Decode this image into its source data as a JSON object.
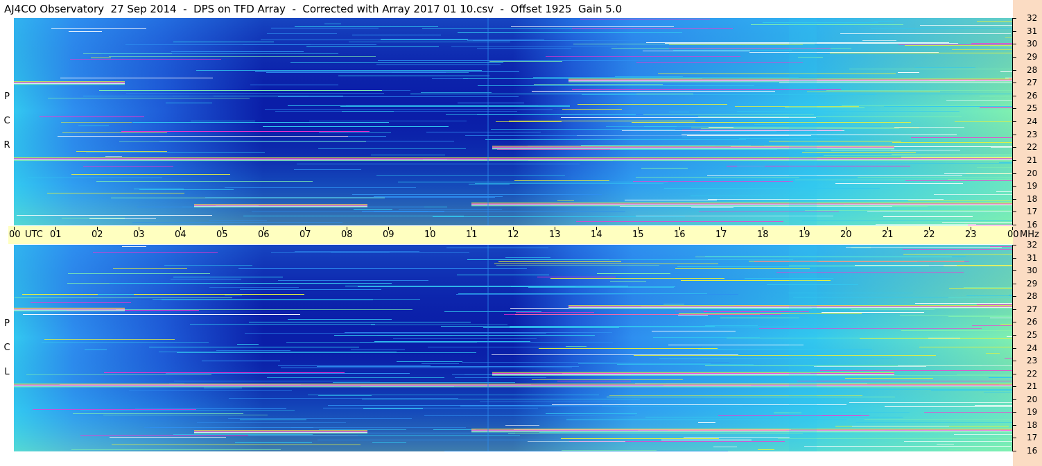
{
  "title": "AJ4CO Observatory  27 Sep 2014  -  DPS on TFD Array  -  Corrected with Array 2017 01 10.csv  -  Offset 1925  Gain 5.0",
  "chart_data": [
    {
      "type": "heatmap",
      "panel": "rcp",
      "ylabel_letters": [
        "P",
        "C",
        "R"
      ],
      "x_unit": "UTC",
      "y_unit": "MHz",
      "x_ticks": [
        "00",
        "01",
        "02",
        "03",
        "04",
        "05",
        "06",
        "07",
        "08",
        "09",
        "10",
        "11",
        "12",
        "13",
        "14",
        "15",
        "16",
        "17",
        "18",
        "19",
        "20",
        "21",
        "22",
        "23",
        "00"
      ],
      "y_ticks": [
        32,
        31,
        30,
        29,
        28,
        27,
        26,
        25,
        24,
        23,
        22,
        21,
        20,
        19,
        18,
        17,
        16
      ],
      "xlim": [
        0,
        24
      ],
      "ylim": [
        16,
        32
      ],
      "colormap": [
        "#0a1ea8",
        "#1e5cd8",
        "#2e8ff0",
        "#32c8f0",
        "#7ff0b0",
        "#e8f23c",
        "#ff2fd0",
        "#ffffff"
      ]
    },
    {
      "type": "heatmap",
      "panel": "lcp",
      "ylabel_letters": [
        "P",
        "C",
        "L"
      ],
      "x_unit": "UTC",
      "y_unit": "MHz",
      "x_ticks": [
        "00",
        "01",
        "02",
        "03",
        "04",
        "05",
        "06",
        "07",
        "08",
        "09",
        "10",
        "11",
        "12",
        "13",
        "14",
        "15",
        "16",
        "17",
        "18",
        "19",
        "20",
        "21",
        "22",
        "23",
        "00"
      ],
      "y_ticks": [
        32,
        31,
        30,
        29,
        28,
        27,
        26,
        25,
        24,
        23,
        22,
        21,
        20,
        19,
        18,
        17,
        16
      ],
      "xlim": [
        0,
        24
      ],
      "ylim": [
        16,
        32
      ],
      "colormap": [
        "#0a1ea8",
        "#1e5cd8",
        "#2e8ff0",
        "#32c8f0",
        "#7ff0b0",
        "#e8f23c",
        "#ff2fd0",
        "#ffffff"
      ]
    }
  ],
  "colors": {
    "axis_band": "#ffffc0",
    "right_strip": "#fbdcc3",
    "quiet_sky": "#1e5cd8",
    "deep_night": "#0a1ea8"
  }
}
